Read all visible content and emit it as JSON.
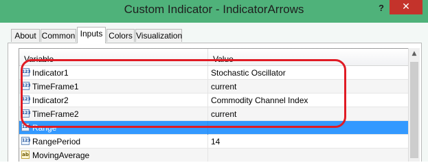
{
  "window": {
    "title": "Custom Indicator - IndicatorArrows",
    "help_label": "?",
    "close_label": "✕"
  },
  "tabs": [
    {
      "label": "About",
      "active": false
    },
    {
      "label": "Common",
      "active": false
    },
    {
      "label": "Inputs",
      "active": true
    },
    {
      "label": "Colors",
      "active": false
    },
    {
      "label": "Visualization",
      "active": false
    }
  ],
  "grid": {
    "columns": [
      "Variable",
      "Value"
    ],
    "rows": [
      {
        "icon": "numeric-input-icon",
        "icon_text": "123",
        "variable": "Indicator1",
        "value": "Stochastic Oscillator",
        "selected": false
      },
      {
        "icon": "numeric-input-icon",
        "icon_text": "123",
        "variable": "TimeFrame1",
        "value": "current",
        "selected": false
      },
      {
        "icon": "numeric-input-icon",
        "icon_text": "123",
        "variable": "Indicator2",
        "value": "Commodity Channel Index",
        "selected": false
      },
      {
        "icon": "numeric-input-icon",
        "icon_text": "123",
        "variable": "TimeFrame2",
        "value": "current",
        "selected": false
      },
      {
        "icon": "numeric-input-icon",
        "icon_text": "123",
        "variable": "Range",
        "value": "",
        "selected": true
      },
      {
        "icon": "numeric-input-icon",
        "icon_text": "123",
        "variable": "RangePeriod",
        "value": "14",
        "selected": false
      },
      {
        "icon": "text-input-icon",
        "icon_text": "ab",
        "variable": "MovingAverage",
        "value": "",
        "selected": false
      }
    ]
  },
  "colors": {
    "titlebar": "#4fb27a",
    "close_button": "#c4332b",
    "selection": "#3399ff",
    "annotation": "#e01b24"
  }
}
